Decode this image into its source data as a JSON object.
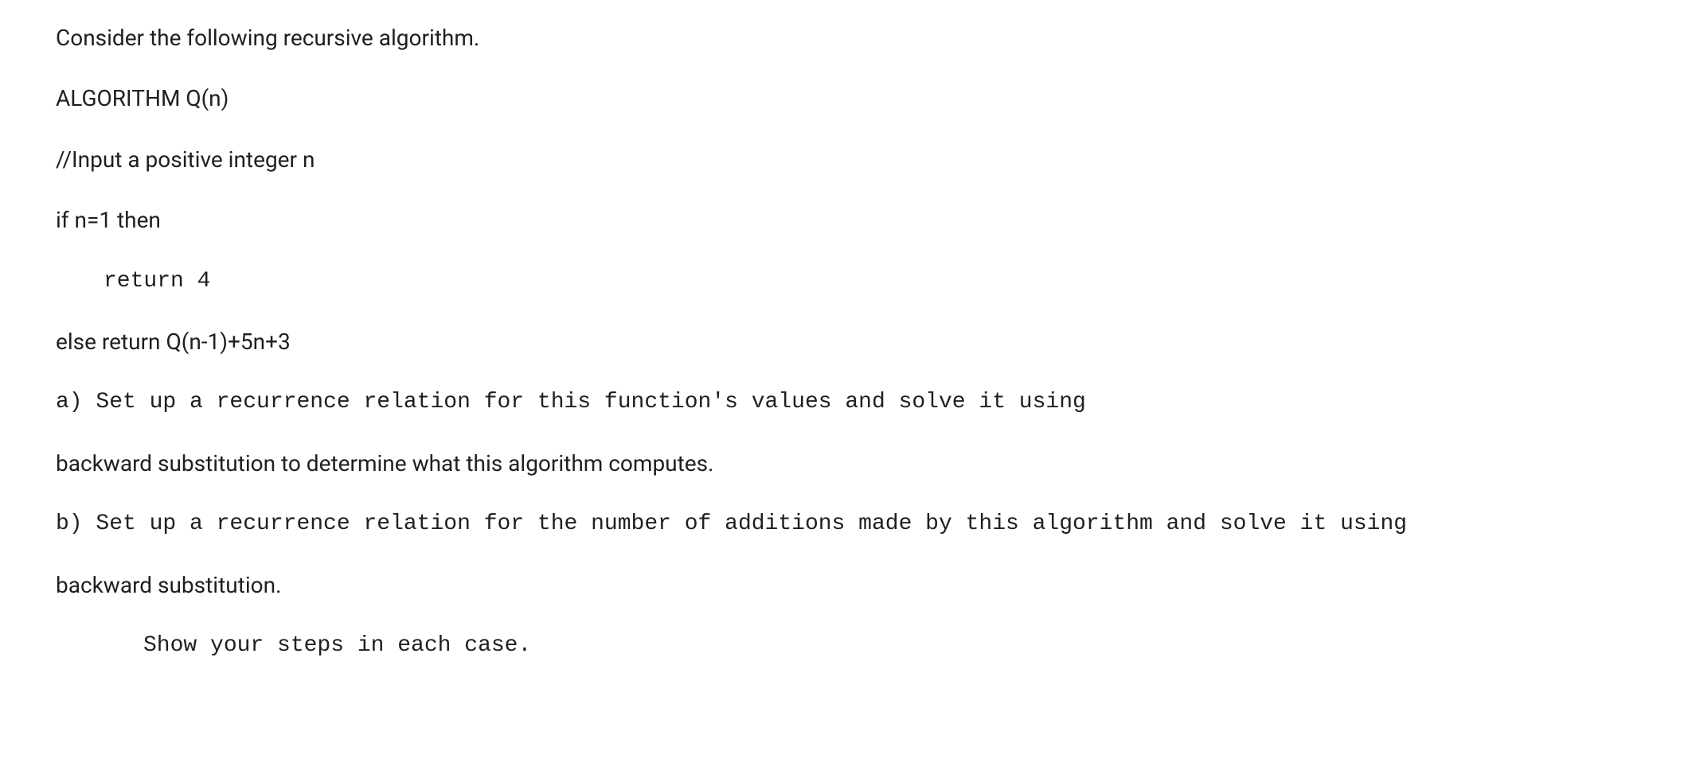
{
  "lines": {
    "l1": "Consider the following recursive algorithm.",
    "l2": "ALGORITHM Q(n)",
    "l3": "//Input a positive integer n",
    "l4": "if n=1 then",
    "l5": "return 4",
    "l6": "else return Q(n-1)+5n+3",
    "l7": "a) Set up a recurrence relation for this function's values and solve it using",
    "l8": "backward substitution to determine what this algorithm computes.",
    "l9": "b) Set up a recurrence relation for the number of additions made by this algorithm and solve it using",
    "l10": "backward substitution.",
    "l11": "Show your steps in each case."
  }
}
